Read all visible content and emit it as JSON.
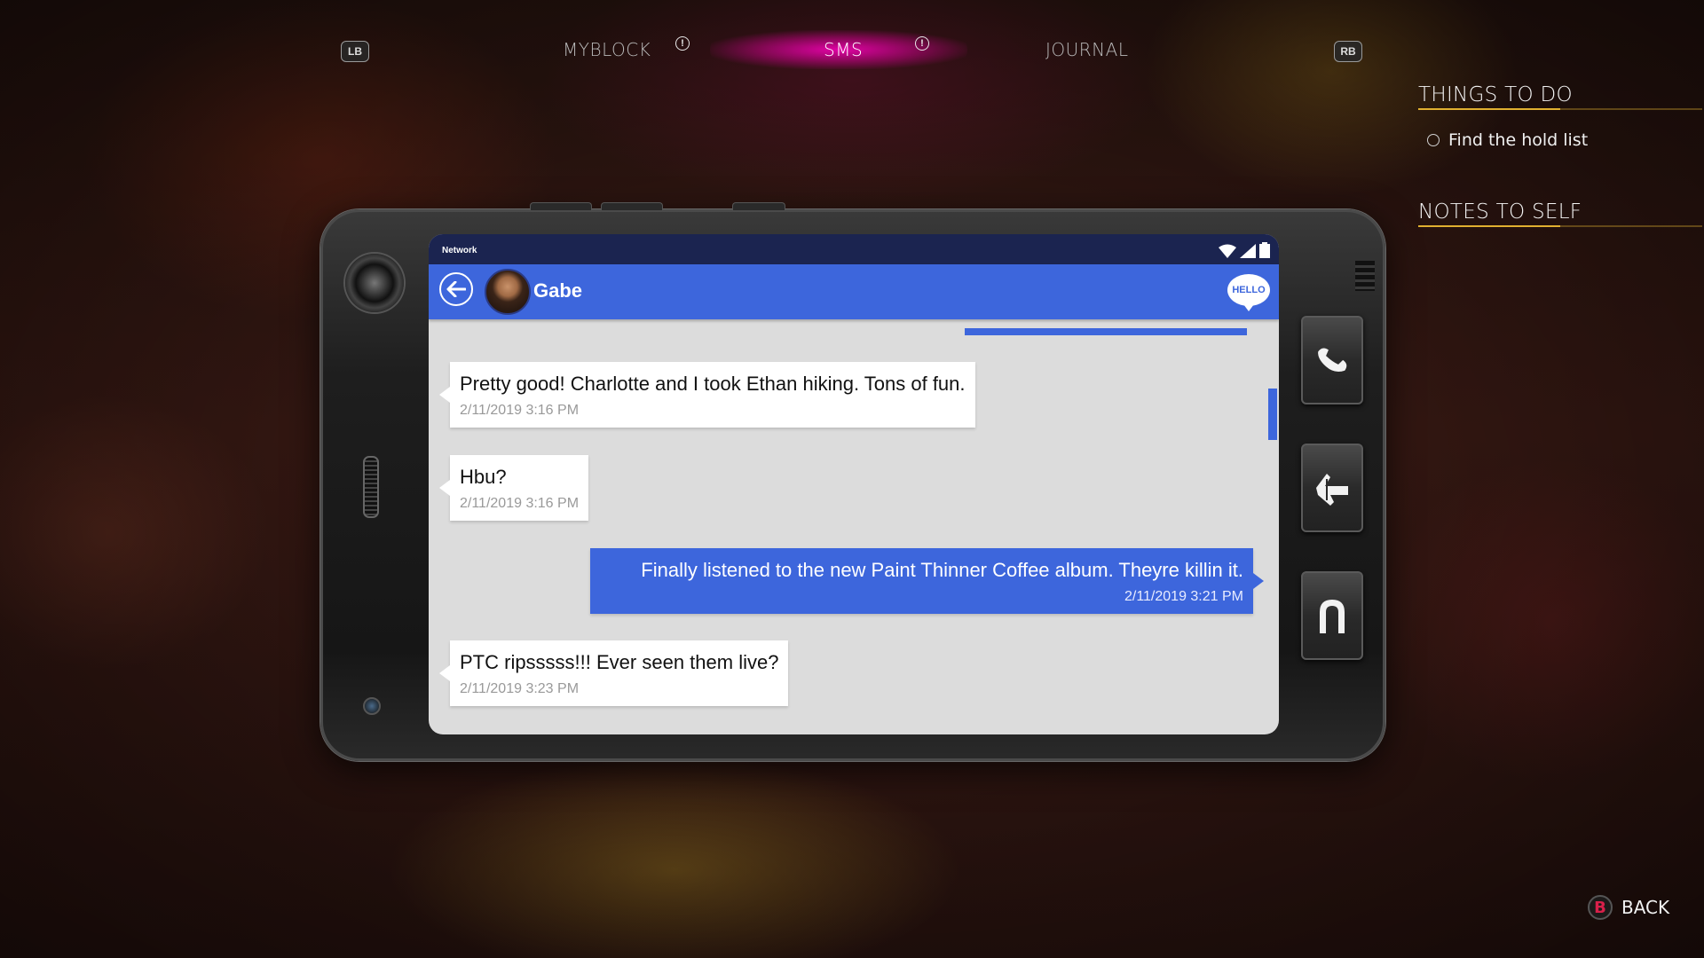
{
  "nav": {
    "left_bumper": "LB",
    "right_bumper": "RB",
    "tabs": [
      {
        "label": "MYBLOCK",
        "alert": "!"
      },
      {
        "label": "SMS",
        "alert": "!"
      },
      {
        "label": "JOURNAL"
      }
    ],
    "active_tab": "SMS"
  },
  "panel": {
    "things_title": "THINGS TO DO",
    "things": [
      "Find the hold list"
    ],
    "notes_title": "NOTES TO SELF"
  },
  "phone": {
    "network": "Network",
    "contact": "Gabe",
    "hello_badge": "HELLO",
    "messages": [
      {
        "direction": "in",
        "text": "Pretty good! Charlotte and I took Ethan hiking. Tons of fun.",
        "time": "2/11/2019 3:16 PM"
      },
      {
        "direction": "in",
        "text": "Hbu?",
        "time": "2/11/2019 3:16 PM"
      },
      {
        "direction": "out",
        "text": "Finally listened to the new Paint Thinner Coffee album. Theyre killin it.",
        "time": "2/11/2019 3:21 PM"
      },
      {
        "direction": "in",
        "text": "PTC ripsssss!!! Ever seen them live?",
        "time": "2/11/2019 3:23 PM"
      }
    ],
    "side_buttons": [
      "phone-icon",
      "hand-icon",
      "magnet-icon"
    ]
  },
  "footer": {
    "back_key": "B",
    "back_label": "BACK"
  },
  "colors": {
    "accent_blue": "#3d66dc",
    "tab_glow": "#ff00be",
    "underline_gold": "#e0b030",
    "b_button": "#d8204a"
  }
}
